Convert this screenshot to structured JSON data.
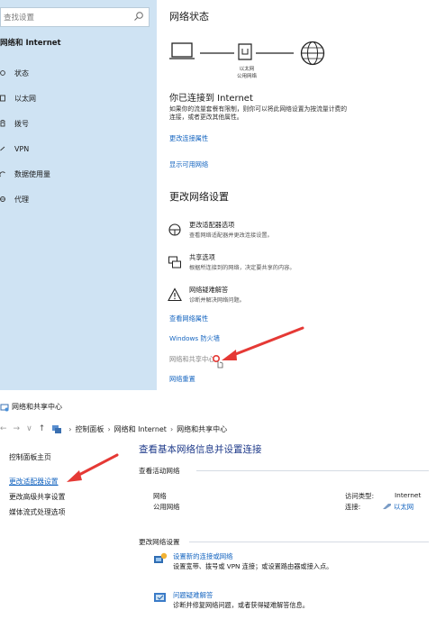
{
  "settings": {
    "search_placeholder": "查找设置",
    "sidebar_heading": "网络和 Internet",
    "sidebar_items": [
      {
        "label": "状态",
        "icon": "status-icon"
      },
      {
        "label": "以太网",
        "icon": "ethernet-icon"
      },
      {
        "label": "拨号",
        "icon": "dialup-icon"
      },
      {
        "label": "VPN",
        "icon": "vpn-icon"
      },
      {
        "label": "数据使用量",
        "icon": "data-usage-icon"
      },
      {
        "label": "代理",
        "icon": "proxy-icon"
      }
    ],
    "network_status_title": "网络状态",
    "diagram_label_line1": "以太网",
    "diagram_label_line2": "公用网络",
    "connected_title": "你已连接到 Internet",
    "connected_desc_line1": "如果你的流量套餐有限制，则你可以将此网络设置为按流量计费的",
    "connected_desc_line2": "连接，或者更改其他属性。",
    "link_change_connection_props": "更改连接属性",
    "link_show_available_networks": "显示可用网络",
    "change_settings_title": "更改网络设置",
    "options": [
      {
        "title": "更改适配器选项",
        "desc": "查看网络适配器并更改连接设置。",
        "icon": "adapter-icon"
      },
      {
        "title": "共享选项",
        "desc": "根据所连接到的网络，决定要共享的内容。",
        "icon": "sharing-icon"
      },
      {
        "title": "网络疑难解答",
        "desc": "诊断并解决网络问题。",
        "icon": "warning-icon"
      }
    ],
    "link_view_network_props": "查看网络属性",
    "link_firewall": "Windows 防火墙",
    "link_sharing_center": "网络和共享中心",
    "link_network_reset": "网络重置"
  },
  "control_panel": {
    "window_title": "网络和共享中心",
    "breadcrumb": [
      "控制面板",
      "网络和 Internet",
      "网络和共享中心"
    ],
    "left_links": {
      "home": "控制面板主页",
      "change_adapter": "更改适配器设置",
      "advanced_sharing": "更改高级共享设置",
      "media_streaming": "媒体流式处理选项"
    },
    "heading": "查看基本网络信息并设置连接",
    "active_networks_label": "查看活动网络",
    "network_name": "网络",
    "network_type": "公用网络",
    "access_type_label": "访问类型:",
    "access_type_value": "Internet",
    "connections_label": "连接:",
    "connections_value": "以太网",
    "change_settings_label": "更改网络设置",
    "tasks": [
      {
        "title": "设置新的连接或网络",
        "desc": "设置宽带、拨号或 VPN 连接；或设置路由器或接入点。",
        "icon": "new-connection-icon"
      },
      {
        "title": "问题疑难解答",
        "desc": "诊断并修复网络问题，或者获得疑难解答信息。",
        "icon": "troubleshoot-icon"
      }
    ]
  },
  "colors": {
    "sidebar_bg": "#cfe3f3",
    "link": "#1565c0",
    "annotation_arrow": "#e53935"
  }
}
